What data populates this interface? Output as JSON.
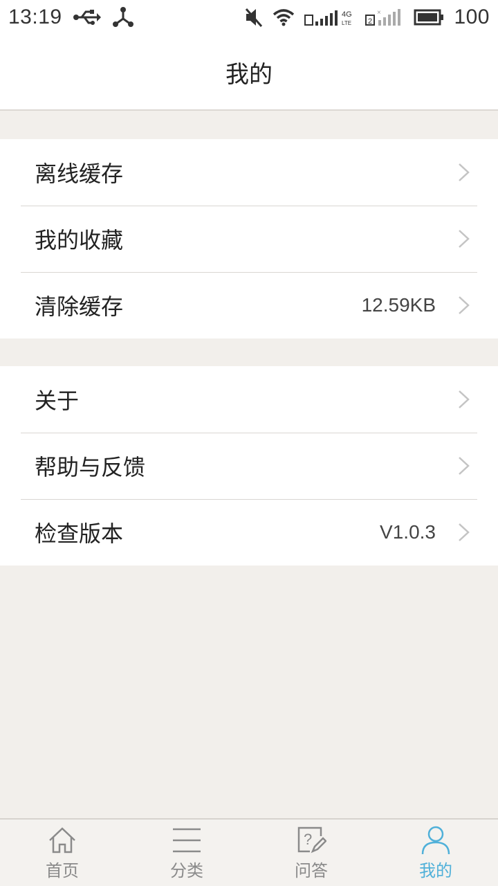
{
  "status_bar": {
    "time": "13:19",
    "battery": "100",
    "icons": [
      "usb-icon",
      "network-share-icon",
      "mute-icon",
      "wifi-icon",
      "sim1-signal-4g-icon",
      "sim2-signal-icon",
      "battery-icon"
    ]
  },
  "header": {
    "title": "我的"
  },
  "groups": [
    {
      "items": [
        {
          "label": "离线缓存",
          "value": ""
        },
        {
          "label": "我的收藏",
          "value": ""
        },
        {
          "label": "清除缓存",
          "value": "12.59KB"
        }
      ]
    },
    {
      "items": [
        {
          "label": "关于",
          "value": ""
        },
        {
          "label": "帮助与反馈",
          "value": ""
        },
        {
          "label": "检查版本",
          "value": "V1.0.3"
        }
      ]
    }
  ],
  "tab_bar": {
    "active_index": 3,
    "active_color": "#4fb0d9",
    "inactive_color": "#8a8a8a",
    "tabs": [
      {
        "label": "首页",
        "icon": "home-icon"
      },
      {
        "label": "分类",
        "icon": "category-icon"
      },
      {
        "label": "问答",
        "icon": "question-answer-icon"
      },
      {
        "label": "我的",
        "icon": "profile-icon"
      }
    ]
  }
}
